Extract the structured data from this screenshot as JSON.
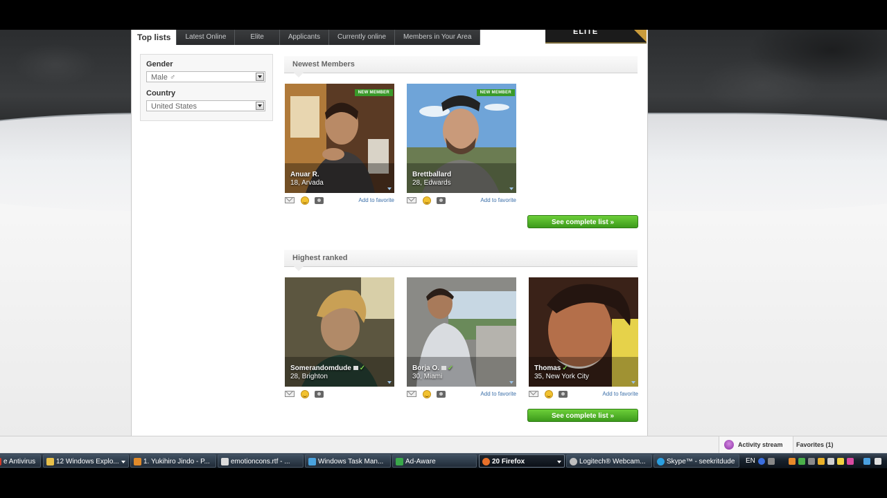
{
  "tabs": [
    {
      "label": "Top lists",
      "active": true
    },
    {
      "label": "Latest Online"
    },
    {
      "label": "Elite"
    },
    {
      "label": "Applicants"
    },
    {
      "label": "Currently online"
    },
    {
      "label": "Members in Your Area"
    }
  ],
  "elite_banner": "ELITE",
  "filters": {
    "gender_label": "Gender",
    "gender_value": "Male ♂",
    "country_label": "Country",
    "country_value": "United States"
  },
  "newest": {
    "title": "Newest Members",
    "see_more": "See complete list »",
    "members": [
      {
        "name": "Anuar R.",
        "location": "18, Arvada",
        "badge": "NEW MEMBER",
        "favorite": "Add to favorite"
      },
      {
        "name": "Brettballard",
        "location": "28, Edwards",
        "badge": "NEW MEMBER",
        "favorite": "Add to favorite"
      }
    ]
  },
  "ranked": {
    "title": "Highest ranked",
    "see_more": "See complete list »",
    "members": [
      {
        "name": "Somerandomdude",
        "location": "28, Brighton",
        "favorite": ""
      },
      {
        "name": "Borja O.",
        "location": "30, Miami",
        "favorite": "Add to favorite"
      },
      {
        "name": "Thomas",
        "location": "35, New York City",
        "favorite": "Add to favorite"
      }
    ]
  },
  "activity_bar": {
    "stream": "Activity stream",
    "favorites": "Favorites (1)"
  },
  "taskbar": {
    "items": [
      {
        "label": "e Antivirus",
        "color": "#d23a2a"
      },
      {
        "label": "12 Windows Explo...",
        "color": "#e8c04a"
      },
      {
        "label": "1. Yukihiro Jindo - P...",
        "color": "#e08a2a"
      },
      {
        "label": "emotioncons.rtf - ...",
        "color": "#dcdcdc"
      },
      {
        "label": "Windows Task Man...",
        "color": "#4aa3df"
      },
      {
        "label": "Ad-Aware",
        "color": "#3aa84a"
      },
      {
        "label": "20 Firefox",
        "color": "#e8702a",
        "active": true
      },
      {
        "label": "Logitech® Webcam...",
        "color": "#bfbfbf"
      },
      {
        "label": "Skype™ - seekritdude",
        "color": "#2a9fe0"
      }
    ],
    "lang": "EN"
  },
  "colors": {
    "accent_green": "#3c9a1b",
    "badge_green": "#3a9a2a",
    "link_blue": "#3a6ea8"
  }
}
